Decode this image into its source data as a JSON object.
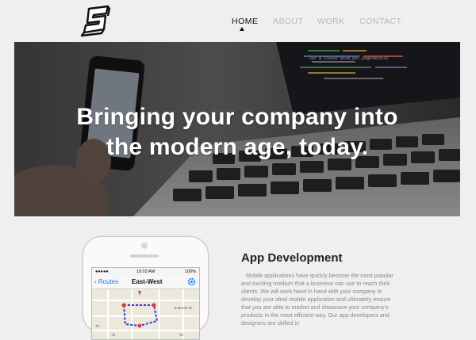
{
  "nav": {
    "items": [
      {
        "label": "HOME",
        "active": true
      },
      {
        "label": "ABOUT",
        "active": false
      },
      {
        "label": "WORK",
        "active": false
      },
      {
        "label": "CONTACT",
        "active": false
      }
    ]
  },
  "hero": {
    "line1": "Bringing your company into",
    "line2": "the modern age, today.",
    "code_text": "var $ Ireset'anim_per_page+Bcat+6'"
  },
  "phone": {
    "status": {
      "time": "10:03 AM",
      "battery": "100%"
    },
    "back_label": "Routes",
    "title": "East-West",
    "map_labels": [
      "E Broad St",
      "70",
      "76",
      "70"
    ]
  },
  "section": {
    "title": "App Development",
    "body": "Mobile applications have quickly become the most popular and exciting medium that a business can use to reach their clients. We will work hand in hand with your company to develop your ideal mobile application and ultimately ensure that you are able to market and showcase your company's products in the most efficient way. Our app developers and designers are skilled in"
  },
  "colors": {
    "accent_blue": "#1a7cf3",
    "nav_active": "#111111",
    "nav_inactive": "#b9b9b9"
  }
}
